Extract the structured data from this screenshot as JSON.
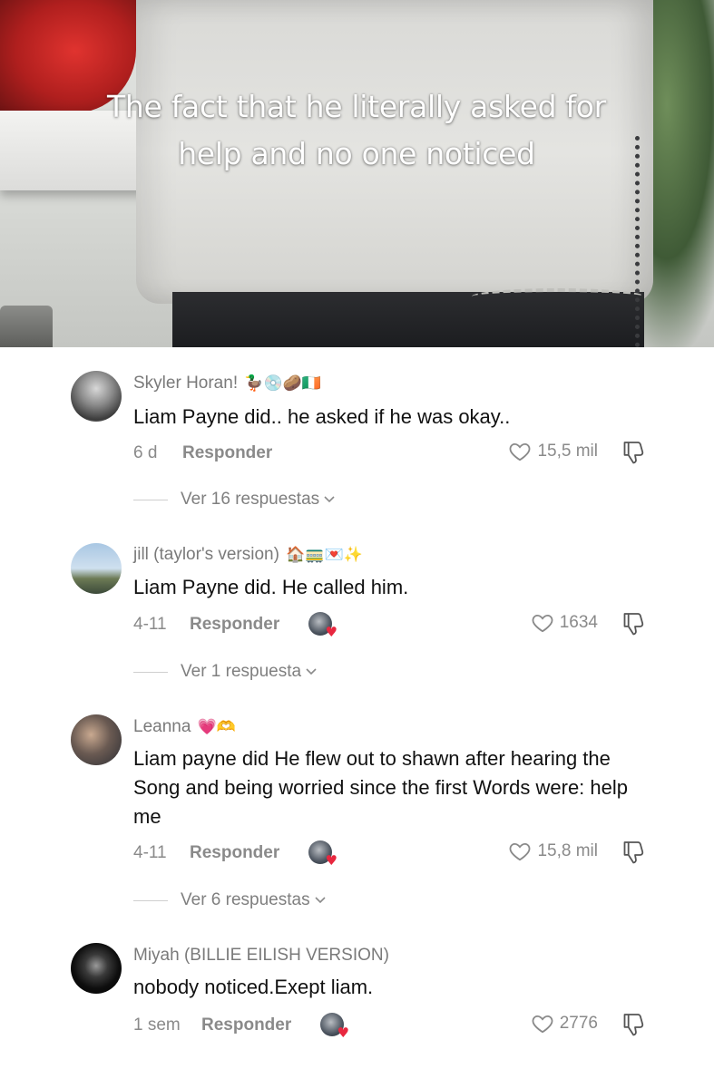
{
  "video": {
    "caption": "The fact that he literally asked for help and no one noticed"
  },
  "comments": [
    {
      "username": "Skyler Horan!",
      "badges": "🦆💿🥔🇮🇪",
      "text": "Liam Payne did.. he asked if he was okay..",
      "date": "6 d",
      "reply_label": "Responder",
      "likes": "15,5 mil",
      "view_replies": "Ver 16 respuestas",
      "liked_by_creator": false
    },
    {
      "username": "jill (taylor's version)",
      "badges": "🏠🚃💌✨",
      "text": "Liam Payne did. He called him.",
      "date": "4-11",
      "reply_label": "Responder",
      "likes": "1634",
      "view_replies": "Ver 1 respuesta",
      "liked_by_creator": true
    },
    {
      "username": "Leanna",
      "badges": "💗🫶",
      "text": "Liam payne did He flew out to shawn after hearing the Song and being worried since the first Words were: help me",
      "date": "4-11",
      "reply_label": "Responder",
      "likes": "15,8 mil",
      "view_replies": "Ver 6 respuestas",
      "liked_by_creator": true
    },
    {
      "username": "Miyah (BILLIE EILISH VERSION)",
      "badges": "",
      "text": "nobody noticed.Exept liam.",
      "date": "1 sem",
      "reply_label": "Responder",
      "likes": "2776",
      "liked_by_creator": true
    }
  ]
}
